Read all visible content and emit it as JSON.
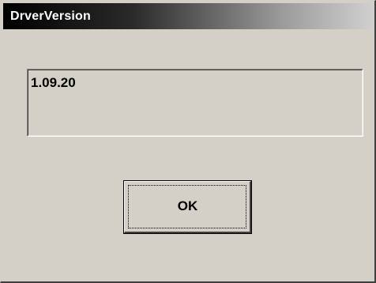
{
  "window": {
    "title": "DrverVersion"
  },
  "version_box": {
    "value": "1.09.20"
  },
  "buttons": {
    "ok_label": "OK"
  },
  "colors": {
    "dialog_background": "#d4d0c8",
    "title_bar_start": "#000000",
    "title_bar_end": "#d0d0d0",
    "title_text": "#ffffff"
  }
}
